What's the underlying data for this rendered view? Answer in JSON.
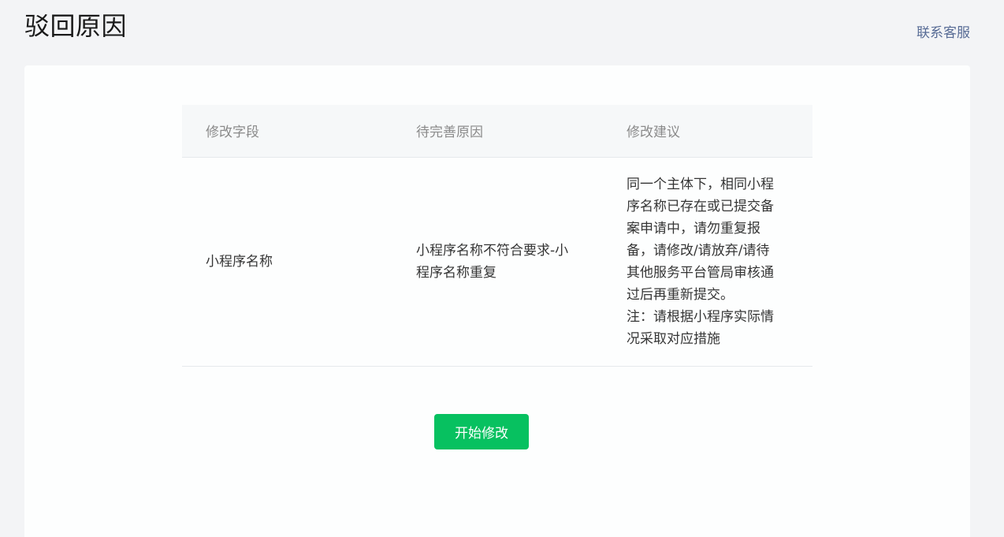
{
  "header": {
    "title": "驳回原因",
    "contact_label": "联系客服"
  },
  "table": {
    "columns": [
      "修改字段",
      "待完善原因",
      "修改建议"
    ],
    "rows": [
      {
        "field": "小程序名称",
        "reason_lines": [
          "小程序名称不符合要求-小",
          "程序名称重复"
        ],
        "advice_lines": [
          "同一个主体下，相同小程",
          "序名称已存在或已提交备",
          "案申请中，请勿重复报",
          "备，请修改/请放弃/请待",
          "其他服务平台管局审核通",
          "过后再重新提交。",
          "注：请根据小程序实际情",
          "况采取对应措施"
        ]
      }
    ]
  },
  "actions": {
    "start_label": "开始修改"
  },
  "colors": {
    "accent": "#07c160",
    "link": "#576b95"
  }
}
